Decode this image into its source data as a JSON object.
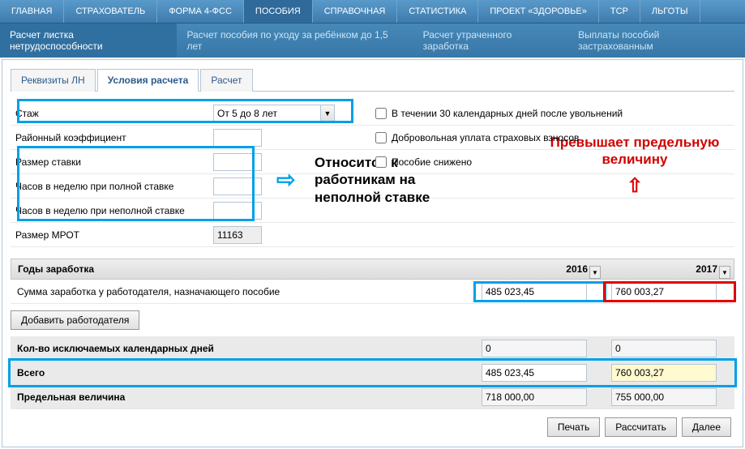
{
  "top_menu": [
    "ГЛАВНАЯ",
    "СТРАХОВАТЕЛЬ",
    "ФОРМА 4-ФСС",
    "ПОСОБИЯ",
    "СПРАВОЧНАЯ",
    "СТАТИСТИКА",
    "ПРОЕКТ «ЗДОРОВЬЕ»",
    "ТСР",
    "ЛЬГОТЫ"
  ],
  "top_menu_active": 3,
  "sub_menu": [
    "Расчет листка нетрудоспособности",
    "Расчет пособия по уходу за ребёнком до 1,5 лет",
    "Расчет утраченного заработка",
    "Выплаты пособий застрахованным"
  ],
  "sub_menu_active": 0,
  "tabs": [
    "Реквизиты ЛН",
    "Условия расчета",
    "Расчет"
  ],
  "tab_active": 1,
  "form": {
    "stazh_label": "Стаж",
    "stazh_value": "От 5 до 8 лет",
    "raion_label": "Районный коэффициент",
    "razmer_label": "Размер ставки",
    "chasov_full_label": "Часов в неделю при полной ставке",
    "chasov_part_label": "Часов в неделю при неполной ставке",
    "mrot_label": "Размер МРОТ",
    "mrot_value": "11163"
  },
  "checks": {
    "c1": "В течении 30 календарных дней после увольнений",
    "c2": "Добровольная уплата страховых взносов",
    "c3": "Пособие снижено"
  },
  "annot": {
    "blue": "Относится к работникам на неполной ставке",
    "red": "Превышает предельную величину"
  },
  "years": {
    "label": "Годы заработка",
    "y1": "2016",
    "y2": "2017"
  },
  "earnings": {
    "label": "Сумма заработка у работодателя, назначающего пособие",
    "v1": "485 023,45",
    "v2": "760 003,27"
  },
  "add_employer": "Добавить работодателя",
  "excluded": {
    "label": "Кол-во исключаемых календарных дней",
    "v1": "0",
    "v2": "0"
  },
  "total": {
    "label": "Всего",
    "v1": "485 023,45",
    "v2": "760 003,27"
  },
  "limit": {
    "label": "Предельная величина",
    "v1": "718 000,00",
    "v2": "755 000,00"
  },
  "buttons": {
    "print": "Печать",
    "calc": "Рассчитать",
    "next": "Далее"
  }
}
